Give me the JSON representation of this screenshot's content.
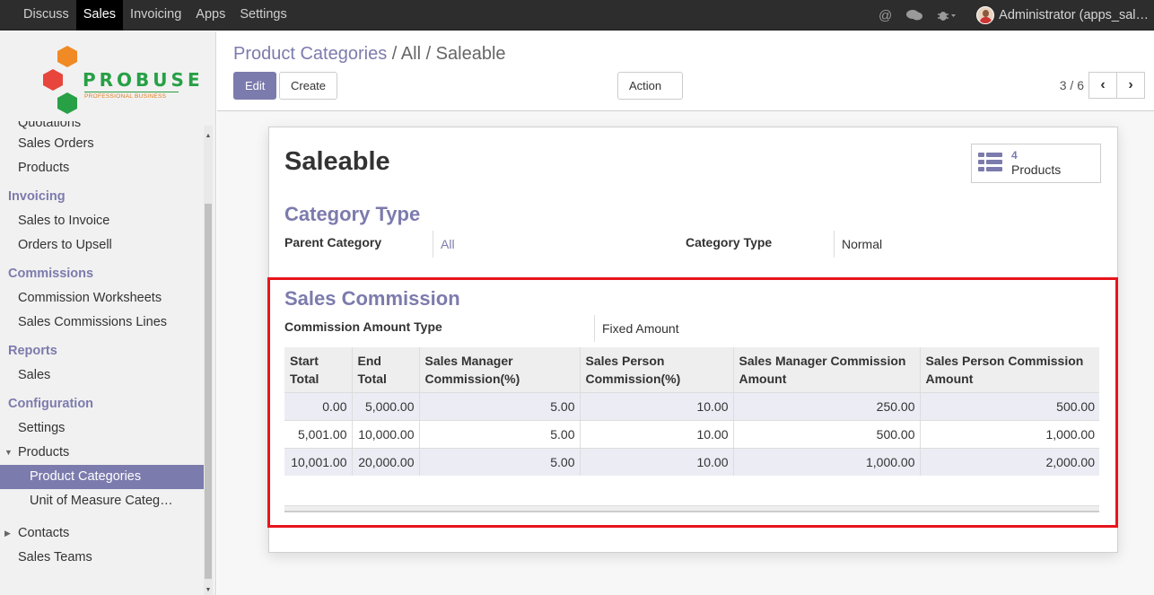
{
  "topbar": {
    "menu": [
      "Discuss",
      "Sales",
      "Invoicing",
      "Apps",
      "Settings"
    ],
    "active": "Sales",
    "user": "Administrator (apps_sal…"
  },
  "logo": {
    "word": "PROBUSE",
    "tagline": "PROFESSIONAL BUSINESS"
  },
  "sidebar": {
    "items": [
      {
        "label": "Quotations",
        "type": "item"
      },
      {
        "label": "Sales Orders",
        "type": "item"
      },
      {
        "label": "Products",
        "type": "item"
      },
      {
        "label": "Invoicing",
        "type": "head"
      },
      {
        "label": "Sales to Invoice",
        "type": "item"
      },
      {
        "label": "Orders to Upsell",
        "type": "item"
      },
      {
        "label": "Commissions",
        "type": "head"
      },
      {
        "label": "Commission Worksheets",
        "type": "item"
      },
      {
        "label": "Sales Commissions Lines",
        "type": "item"
      },
      {
        "label": "Reports",
        "type": "head"
      },
      {
        "label": "Sales",
        "type": "item"
      },
      {
        "label": "Configuration",
        "type": "head"
      },
      {
        "label": "Settings",
        "type": "item"
      },
      {
        "label": "Products",
        "type": "item"
      },
      {
        "label": "Product Categories",
        "type": "sub"
      },
      {
        "label": "Unit of Measure Categ…",
        "type": "sub"
      },
      {
        "label": "Contacts",
        "type": "item"
      },
      {
        "label": "Sales Teams",
        "type": "item"
      }
    ]
  },
  "breadcrumb": {
    "root": "Product Categories",
    "sep": " / ",
    "current": "All / Saleable"
  },
  "buttons": {
    "edit": "Edit",
    "create": "Create",
    "action": "Action"
  },
  "pager": {
    "text": "3 / 6",
    "prev": "‹",
    "next": "›"
  },
  "record": {
    "name": "Saleable",
    "smart_button": {
      "count": "4",
      "label": "Products"
    },
    "category_type_section": "Category Type",
    "parent_category_label": "Parent Category",
    "parent_category_value": "All",
    "category_type_label": "Category Type",
    "category_type_value": "Normal",
    "commission_section": "Sales Commission",
    "commission_amount_type_label": "Commission Amount Type",
    "commission_amount_type_value": "Fixed Amount"
  },
  "commission_table": {
    "columns": [
      "Start Total",
      "End Total",
      "Sales Manager Commission(%)",
      "Sales Person Commission(%)",
      "Sales Manager Commission Amount",
      "Sales Person Commission Amount"
    ],
    "rows": [
      [
        "0.00",
        "5,000.00",
        "5.00",
        "10.00",
        "250.00",
        "500.00"
      ],
      [
        "5,001.00",
        "10,000.00",
        "5.00",
        "10.00",
        "500.00",
        "1,000.00"
      ],
      [
        "10,001.00",
        "20,000.00",
        "5.00",
        "10.00",
        "1,000.00",
        "2,000.00"
      ]
    ]
  },
  "colors": {
    "accent": "#7c7bad",
    "highlight": "#e8141c",
    "topbar": "#2d2d2d"
  }
}
